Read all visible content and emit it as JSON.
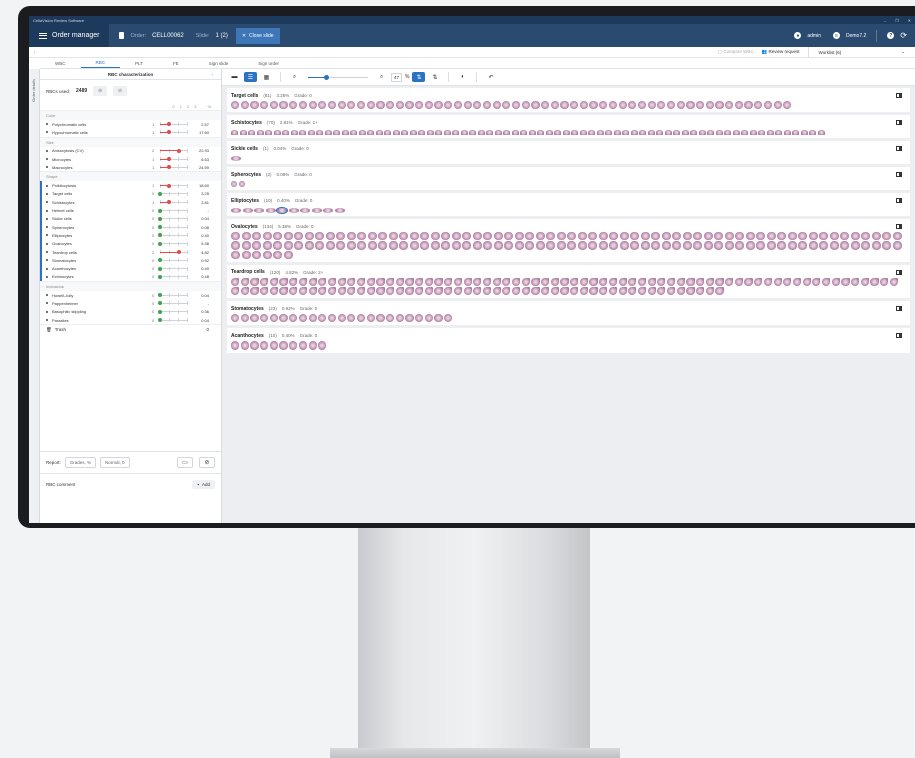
{
  "window": {
    "title": "CellaVision Review Software",
    "controls": [
      "–",
      "❐",
      "✕"
    ]
  },
  "appbar": {
    "order_manager": "Order manager",
    "order_label": "Order:",
    "order_value": "CELL00062",
    "slide_label": "Slide:",
    "slide_value": "1 (2)",
    "close_slide": "Close slide",
    "user": "admin",
    "database": "Demo7.2",
    "help": "?"
  },
  "toolbar2": {
    "compare": "Compare WBC",
    "review_request": "Review request",
    "worklist": "Worklist (6)"
  },
  "tabs": [
    "WBC",
    "RBC",
    "PLT",
    "FE",
    "Sign slide",
    "Sign order"
  ],
  "active_tab": "RBC",
  "side_label": "Order details",
  "left": {
    "header": "RBC characterization",
    "rbcs_used_label": "RBCs used:",
    "rbcs_used_value": "2489",
    "scale": [
      "0",
      "1",
      "2",
      "3",
      "%"
    ],
    "groups": [
      {
        "title": "Color",
        "rows": [
          {
            "name": "Polychromatic cells",
            "grade": "1",
            "level": 1,
            "value": "2.57"
          },
          {
            "name": "Hypochromatic cells",
            "grade": "1",
            "level": 1,
            "value": "17.60"
          }
        ]
      },
      {
        "title": "Size",
        "rows": [
          {
            "name": "Anisocytosis (CV)",
            "grade": "2",
            "level": 2,
            "value": "22.93"
          },
          {
            "name": "Microcytes",
            "grade": "1",
            "level": 1,
            "value": "6.63"
          },
          {
            "name": "Macrocytes",
            "grade": "1",
            "level": 1,
            "value": "24.59"
          }
        ]
      },
      {
        "title": "Shape",
        "rows": [
          {
            "name": "Poikilocytosis",
            "grade": "1",
            "level": 1,
            "value": "18.60"
          },
          {
            "name": "Target cells",
            "grade": "0",
            "level": 0,
            "value": "3.25"
          },
          {
            "name": "Schistocytes",
            "grade": "1",
            "level": 1,
            "value": "2.81"
          },
          {
            "name": "Helmet cells",
            "grade": "0",
            "level": 0,
            "value": "-"
          },
          {
            "name": "Sickle cells",
            "grade": "0",
            "level": 0,
            "value": "0.04"
          },
          {
            "name": "Spherocytes",
            "grade": "0",
            "level": 0,
            "value": "0.08"
          },
          {
            "name": "Elliptocytes",
            "grade": "0",
            "level": 0,
            "value": "0.40"
          },
          {
            "name": "Ovalocytes",
            "grade": "0",
            "level": 0,
            "value": "5.38"
          },
          {
            "name": "Teardrop cells",
            "grade": "2",
            "level": 2,
            "value": "4.82"
          },
          {
            "name": "Stomatocytes",
            "grade": "0",
            "level": 0,
            "value": "0.92"
          },
          {
            "name": "Acanthocytes",
            "grade": "0",
            "level": 0,
            "value": "0.40"
          },
          {
            "name": "Echinocytes",
            "grade": "0",
            "level": 0,
            "value": "0.48"
          }
        ]
      },
      {
        "title": "Inclusions",
        "rows": [
          {
            "name": "Howell-Jolly",
            "grade": "0",
            "level": 0,
            "value": "0.04"
          },
          {
            "name": "Pappenheimer",
            "grade": "0",
            "level": 0,
            "value": "-"
          },
          {
            "name": "Basophilic stippling",
            "grade": "0",
            "level": 0,
            "value": "0.36"
          },
          {
            "name": "Parasites",
            "grade": "0",
            "level": 0,
            "value": "0.04"
          }
        ]
      }
    ],
    "trash_label": "Trash",
    "trash_value": "0",
    "report_label": "Report:",
    "report_chip1": "Grades, %",
    "report_chip2": "Normal, 0",
    "comment_label": "RBC comment",
    "add_label": "Add"
  },
  "viewer": {
    "zoom": "47",
    "zoom_unit": "%",
    "sections": [
      {
        "title": "Target cells",
        "count": "(81)",
        "pct": "3.25%",
        "grade": "Grade: 0",
        "cells": 58,
        "kind": ""
      },
      {
        "title": "Schistocytes",
        "count": "(70)",
        "pct": "2.81%",
        "grade": "Grade: 1+",
        "cells": 70,
        "kind": "frag"
      },
      {
        "title": "Sickle cells",
        "count": "(1)",
        "pct": "0.04%",
        "grade": "Grade: 0",
        "cells": 1,
        "kind": "ell"
      },
      {
        "title": "Spherocytes",
        "count": "(2)",
        "pct": "0.08%",
        "grade": "Grade: 0",
        "cells": 2,
        "kind": "sm"
      },
      {
        "title": "Elliptocytes",
        "count": "(10)",
        "pct": "0.40%",
        "grade": "Grade: 0",
        "cells": 10,
        "kind": "ell"
      },
      {
        "title": "Ovalocytes",
        "count": "(134)",
        "pct": "5.38%",
        "grade": "Grade: 0",
        "cells": 134,
        "kind": "ov"
      },
      {
        "title": "Teardrop cells",
        "count": "(120)",
        "pct": "4.82%",
        "grade": "Grade: 2+",
        "cells": 120,
        "kind": "tear"
      },
      {
        "title": "Stomatocytes",
        "count": "(23)",
        "pct": "0.92%",
        "grade": "Grade: 0",
        "cells": 23,
        "kind": ""
      },
      {
        "title": "Acanthocytes",
        "count": "(10)",
        "pct": "0.40%",
        "grade": "Grade: 0",
        "cells": 10,
        "kind": ""
      }
    ]
  },
  "colors": {
    "accent": "#2a72c2",
    "titlebar": "#1d3a5c",
    "appbar": "#2a4a70",
    "grade_high": "#e34a4a",
    "grade_zero": "#3fa34d"
  }
}
